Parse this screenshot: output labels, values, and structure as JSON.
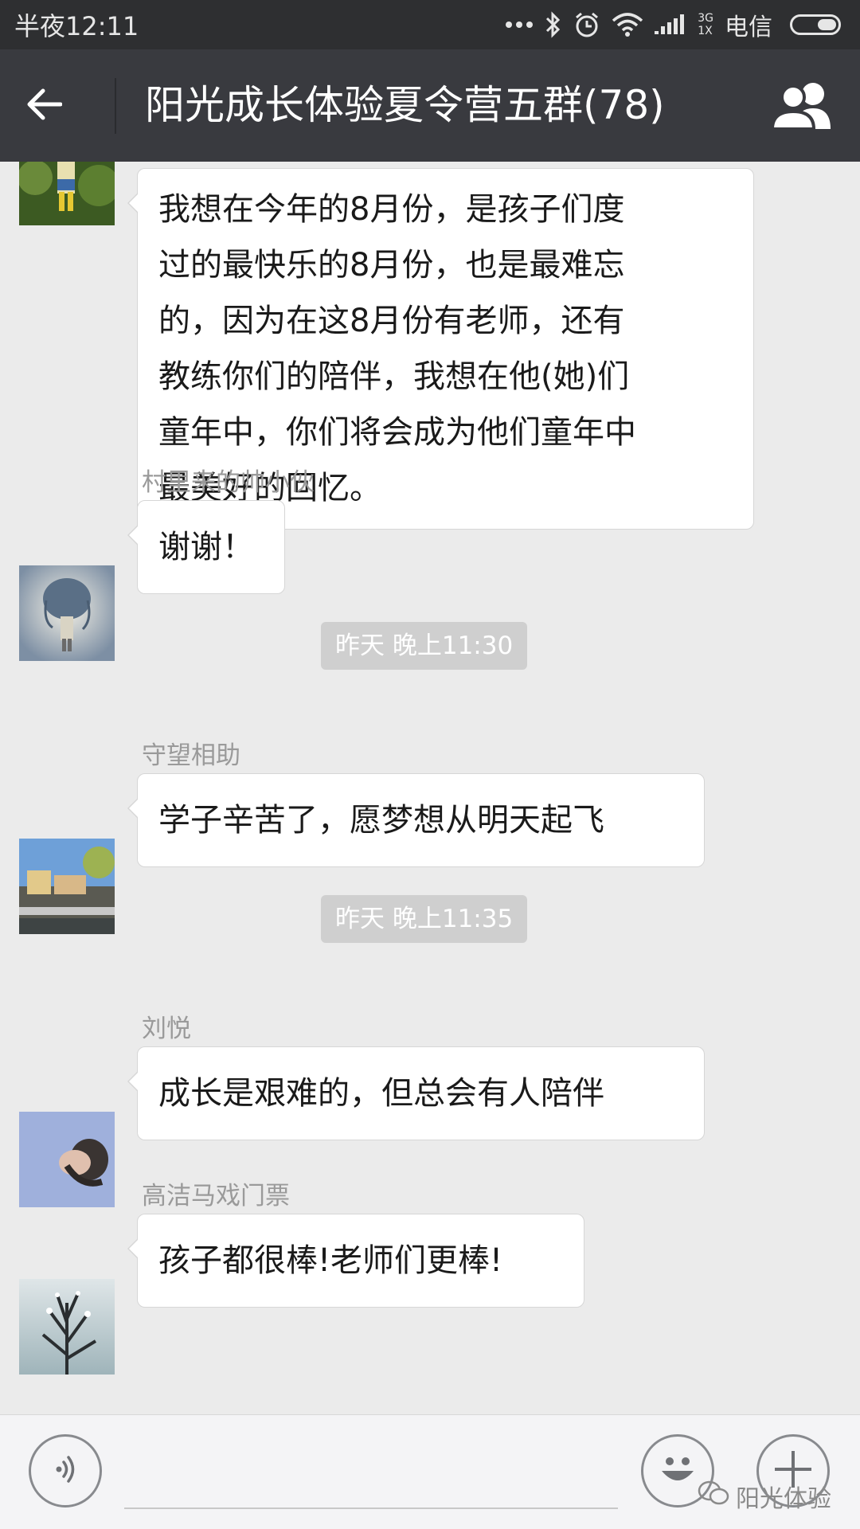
{
  "status_bar": {
    "time": "半夜12:11",
    "network_top": "3G",
    "network_bottom": "1X",
    "carrier": "电信",
    "battery_level": 0.45
  },
  "header": {
    "title": "阳光成长体验夏令营五群(78)"
  },
  "messages": [
    {
      "lines": [
        "我想在今年的8月份，是孩子们度",
        "过的最快乐的8月份，也是最难忘",
        "的，因为在这8月份有老师，还有",
        "教练你们的陪伴，我想在他(她)们",
        "童年中，你们将会成为他们童年中",
        "最美好的回忆。"
      ]
    },
    {
      "sender": "村里来的帅小伙",
      "text": "谢谢！"
    },
    {
      "sender": "守望相助",
      "text": "学子辛苦了，愿梦想从明天起飞"
    },
    {
      "sender": "刘悦",
      "text": "成长是艰难的，但总会有人陪伴"
    },
    {
      "sender": "高洁马戏门票",
      "text": "孩子都很棒!老师们更棒!"
    }
  ],
  "timestamps": [
    "昨天 晚上11:30",
    "昨天 晚上11:35"
  ],
  "watermark": "阳光体验",
  "icons": {
    "back": "arrow-left-icon",
    "members": "group-members-icon",
    "voice": "voice-icon",
    "emoji": "emoji-icon",
    "more": "plus-icon"
  },
  "colors": {
    "status_bar": "#2e2f31",
    "title_bar": "#393a3f",
    "chat_background": "#ebebeb",
    "bubble": "#ffffff",
    "timestamp_pill": "#cfcfcf"
  }
}
